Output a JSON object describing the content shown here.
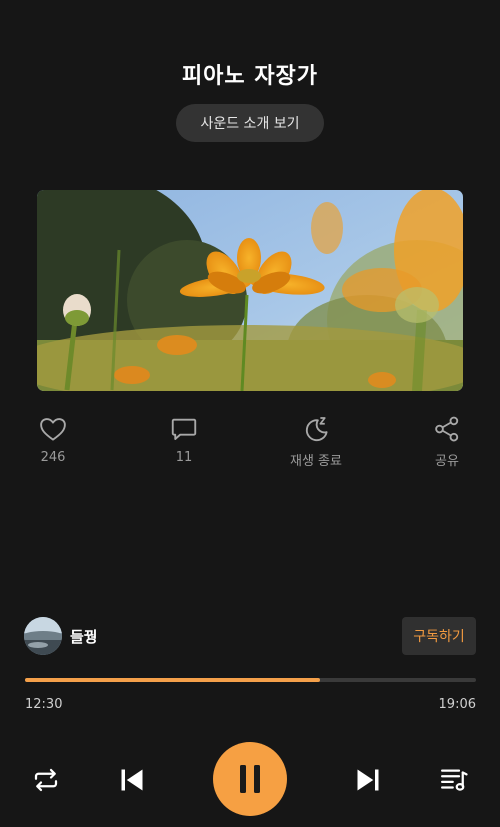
{
  "player": {
    "title": "피아노 자장가",
    "intro_button_label": "사운드 소개 보기"
  },
  "actions": [
    {
      "icon": "heart-icon",
      "label": "246"
    },
    {
      "icon": "comment-icon",
      "label": "11"
    },
    {
      "icon": "moon-sleep-icon",
      "label": "재생 종료"
    },
    {
      "icon": "share-icon",
      "label": "공유"
    }
  ],
  "creator": {
    "name": "들꿩",
    "subscribe_label": "구독하기"
  },
  "progress": {
    "current": "12:30",
    "total": "19:06",
    "fraction": 0.654
  },
  "colors": {
    "accent": "#f6a043",
    "background": "#161616"
  },
  "controls": {
    "repeat_icon": "repeat-icon",
    "prev_icon": "skip-previous-icon",
    "play_pause_icon": "pause-icon",
    "next_icon": "skip-next-icon",
    "playlist_icon": "playlist-icon"
  }
}
